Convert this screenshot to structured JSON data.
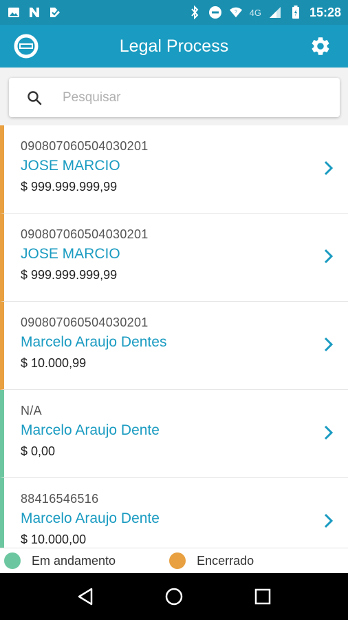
{
  "status_bar": {
    "network_label": "4G",
    "time": "15:28"
  },
  "app_bar": {
    "title": "Legal Process"
  },
  "search": {
    "placeholder": "Pesquisar",
    "value": ""
  },
  "processes": [
    {
      "code": "090807060504030201",
      "name": "JOSE MARCIO",
      "amount": "$ 999.999.999,99",
      "status": "encerrado"
    },
    {
      "code": "090807060504030201",
      "name": "JOSE MARCIO",
      "amount": "$ 999.999.999,99",
      "status": "encerrado"
    },
    {
      "code": "090807060504030201",
      "name": "Marcelo Araujo Dentes",
      "amount": "$ 10.000,99",
      "status": "encerrado"
    },
    {
      "code": "N/A",
      "name": "Marcelo Araujo Dente",
      "amount": "$ 0,00",
      "status": "em_andamento"
    },
    {
      "code": "88416546516",
      "name": "Marcelo Araujo Dente",
      "amount": "$ 10.000,00",
      "status": "em_andamento"
    }
  ],
  "legend": {
    "in_progress_label": "Em andamento",
    "closed_label": "Encerrado"
  },
  "colors": {
    "primary": "#1a9bc1",
    "in_progress": "#6cc7a0",
    "closed": "#e8a040"
  }
}
